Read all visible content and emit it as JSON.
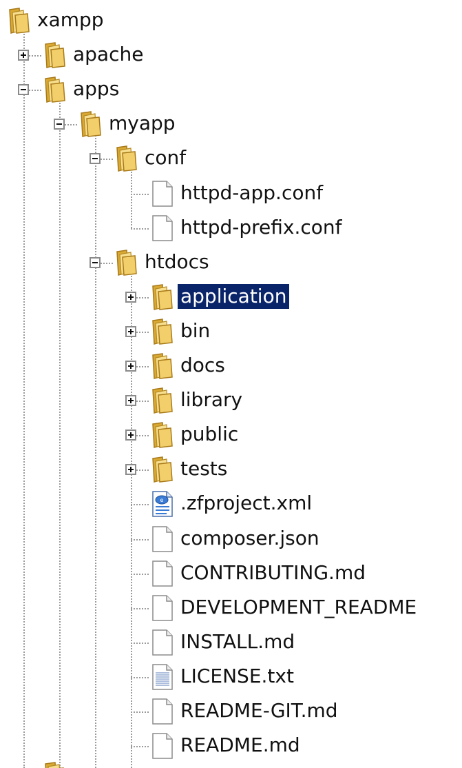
{
  "tree": {
    "nodes": [
      {
        "id": "xampp",
        "label": "xampp",
        "type": "folder",
        "depth": 0,
        "expander": "none"
      },
      {
        "id": "apache",
        "label": "apache",
        "type": "folder",
        "depth": 1,
        "expander": "plus"
      },
      {
        "id": "apps",
        "label": "apps",
        "type": "folder",
        "depth": 1,
        "expander": "minus"
      },
      {
        "id": "myapp",
        "label": "myapp",
        "type": "folder",
        "depth": 2,
        "expander": "minus"
      },
      {
        "id": "conf",
        "label": "conf",
        "type": "folder",
        "depth": 3,
        "expander": "minus"
      },
      {
        "id": "httpd-app-conf",
        "label": "httpd-app.conf",
        "type": "file",
        "depth": 4,
        "expander": "none"
      },
      {
        "id": "httpd-prefix-conf",
        "label": "httpd-prefix.conf",
        "type": "file",
        "depth": 4,
        "expander": "none"
      },
      {
        "id": "htdocs",
        "label": "htdocs",
        "type": "folder",
        "depth": 3,
        "expander": "minus"
      },
      {
        "id": "application",
        "label": "application",
        "type": "folder",
        "depth": 4,
        "expander": "plus",
        "selected": true
      },
      {
        "id": "bin",
        "label": "bin",
        "type": "folder",
        "depth": 4,
        "expander": "plus"
      },
      {
        "id": "docs",
        "label": "docs",
        "type": "folder",
        "depth": 4,
        "expander": "plus"
      },
      {
        "id": "library",
        "label": "library",
        "type": "folder",
        "depth": 4,
        "expander": "plus"
      },
      {
        "id": "public",
        "label": "public",
        "type": "folder",
        "depth": 4,
        "expander": "plus"
      },
      {
        "id": "tests",
        "label": "tests",
        "type": "folder",
        "depth": 4,
        "expander": "plus"
      },
      {
        "id": "zfproject-xml",
        "label": ".zfproject.xml",
        "type": "xml",
        "depth": 4,
        "expander": "none"
      },
      {
        "id": "composer-json",
        "label": "composer.json",
        "type": "file",
        "depth": 4,
        "expander": "none"
      },
      {
        "id": "contributing-md",
        "label": "CONTRIBUTING.md",
        "type": "file",
        "depth": 4,
        "expander": "none"
      },
      {
        "id": "development-readme",
        "label": "DEVELOPMENT_README",
        "type": "file",
        "depth": 4,
        "expander": "none"
      },
      {
        "id": "install-md",
        "label": "INSTALL.md",
        "type": "file",
        "depth": 4,
        "expander": "none"
      },
      {
        "id": "license-txt",
        "label": "LICENSE.txt",
        "type": "text",
        "depth": 4,
        "expander": "none"
      },
      {
        "id": "readme-git-md",
        "label": "README-GIT.md",
        "type": "file",
        "depth": 4,
        "expander": "none"
      },
      {
        "id": "readme-md",
        "label": "README.md",
        "type": "file",
        "depth": 4,
        "expander": "none"
      }
    ]
  },
  "colors": {
    "selection_bg": "#0a246a",
    "selection_text": "#ffffff",
    "folder_body": "#f2cf6a",
    "tree_lines": "#9b9b9b"
  }
}
